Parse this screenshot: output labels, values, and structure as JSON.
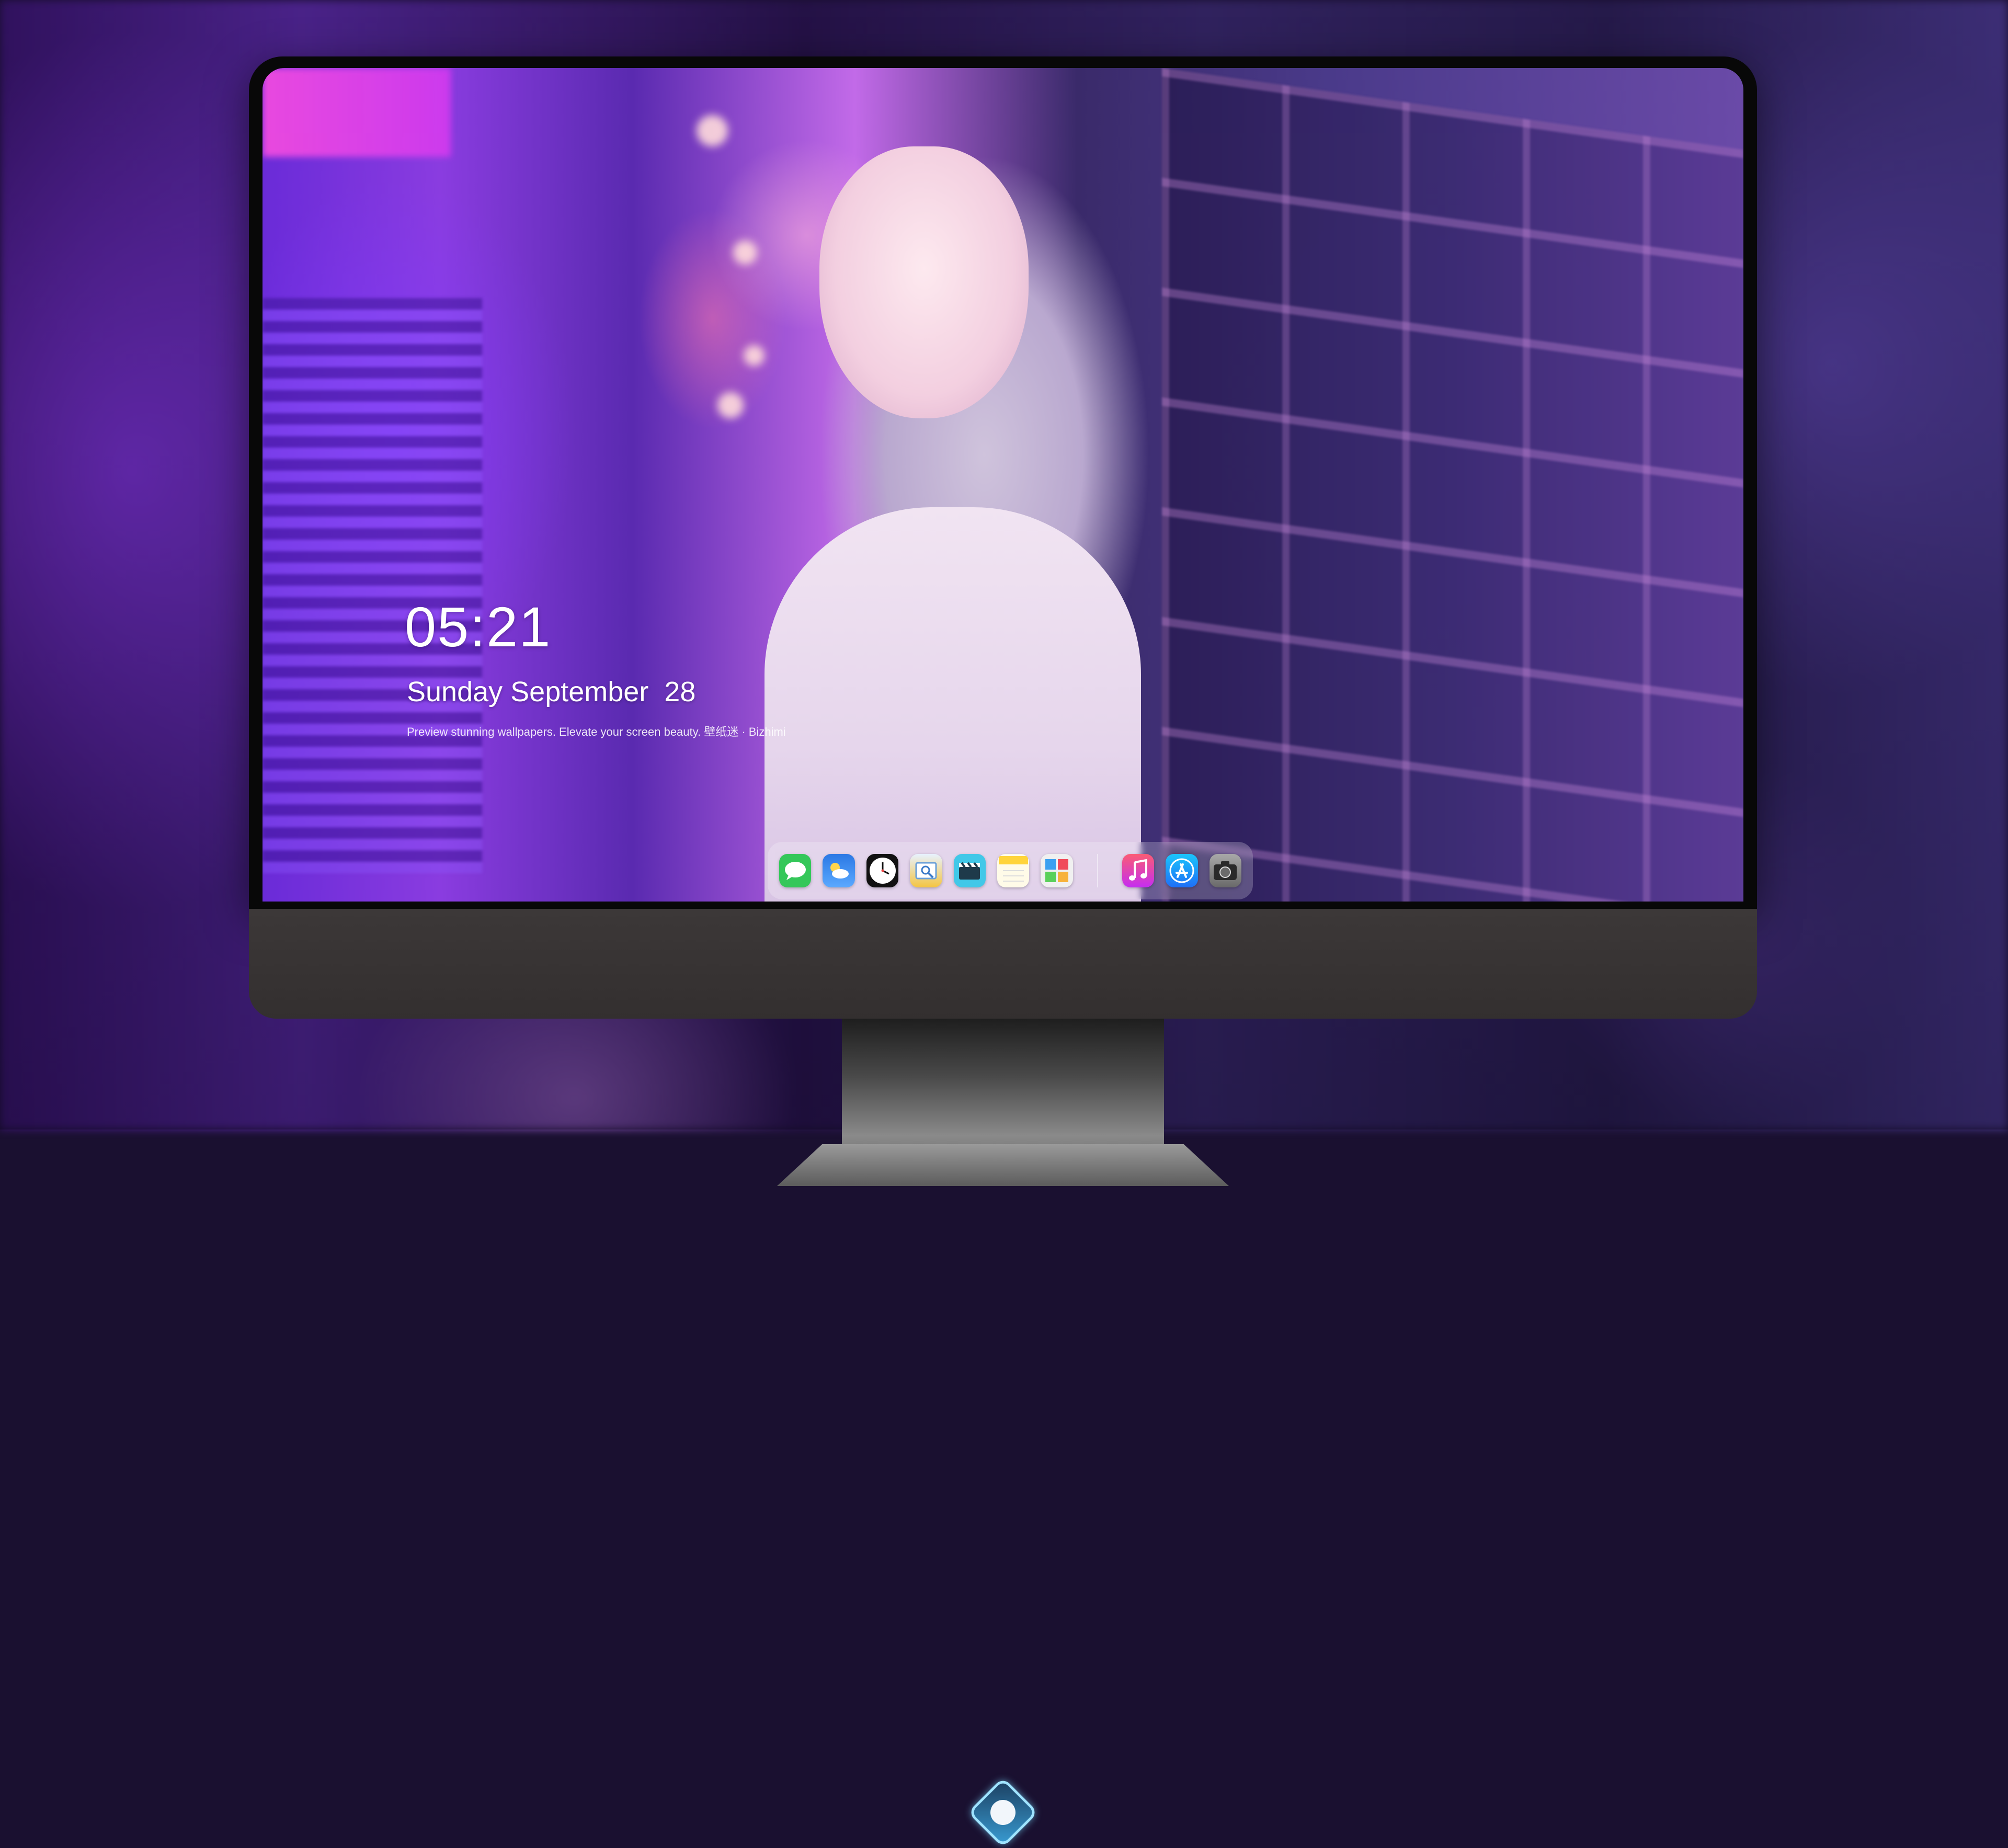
{
  "lock_screen": {
    "time": "05:21",
    "date": "Sunday September  28",
    "caption": "Preview stunning wallpapers. Elevate your screen beauty. 壁纸迷 · Bizhimi"
  },
  "dock": {
    "apps": [
      {
        "name": "Messages",
        "icon": "message-bubble-icon",
        "color": "#34c759"
      },
      {
        "name": "Weather",
        "icon": "cloud-sun-icon",
        "color": "#3a8ef0"
      },
      {
        "name": "Clock",
        "icon": "clock-icon",
        "color": "#111111"
      },
      {
        "name": "Preview",
        "icon": "preview-icon",
        "color": "#f4c542"
      },
      {
        "name": "Clips",
        "icon": "clapperboard-icon",
        "color": "#41c8e8"
      },
      {
        "name": "Notes",
        "icon": "notes-icon",
        "color": "#ffd43b"
      },
      {
        "name": "Photo Booth",
        "icon": "photo-booth-icon",
        "color": "#e8e8e8"
      },
      {
        "name": "Music",
        "icon": "music-note-icon",
        "color": "#fa2d6e"
      },
      {
        "name": "App Store",
        "icon": "app-store-icon",
        "color": "#1e8ff7"
      },
      {
        "name": "Camera",
        "icon": "camera-icon",
        "color": "#8c8c8c"
      }
    ]
  },
  "colors": {
    "accent_purple": "#8a3ce0",
    "bezel": "#080808",
    "chin": "#3a3636"
  }
}
